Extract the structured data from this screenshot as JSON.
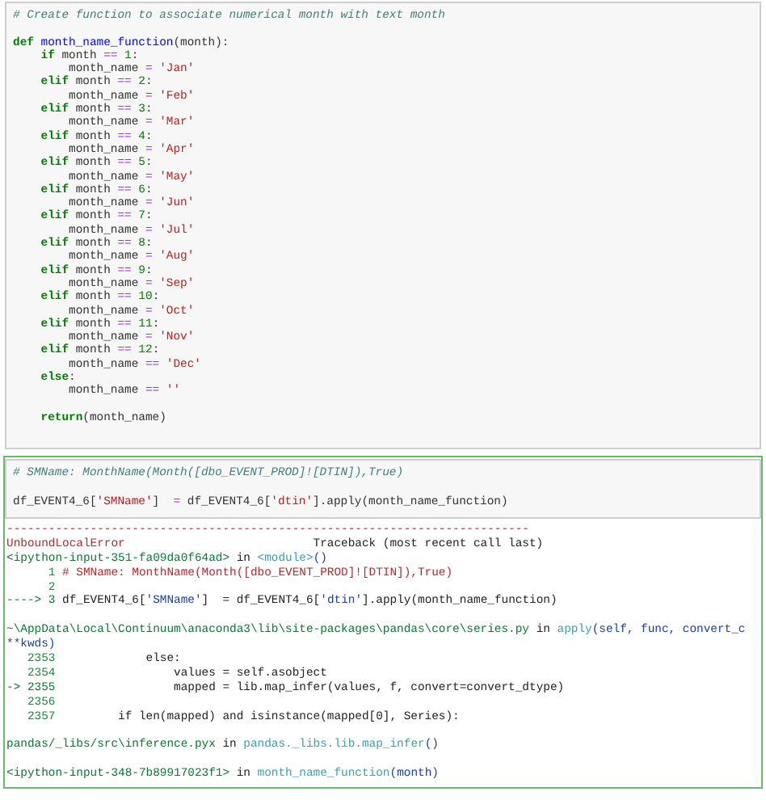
{
  "cells": [
    {
      "selected": false,
      "lines": [
        {
          "kind": "code",
          "tokens": [
            {
              "kind": "cm",
              "t": "# Create function to associate numerical month with text month"
            }
          ]
        },
        {
          "kind": "blank"
        },
        {
          "kind": "code",
          "tokens": [
            {
              "kind": "kw",
              "t": "def"
            },
            {
              "kind": "fn",
              "t": " month_name_function"
            },
            {
              "kind": "tx",
              "t": "(month):"
            }
          ]
        },
        {
          "kind": "code",
          "tokens": [
            {
              "kind": "kw",
              "t": "    if"
            },
            {
              "kind": "tx",
              "t": " month "
            },
            {
              "kind": "op",
              "t": "=="
            },
            {
              "kind": "num",
              "t": " 1"
            },
            {
              "kind": "tx",
              "t": ":"
            }
          ]
        },
        {
          "kind": "code",
          "tokens": [
            {
              "kind": "tx",
              "t": "        month_name "
            },
            {
              "kind": "op",
              "t": "="
            },
            {
              "kind": "str",
              "t": " 'Jan'"
            }
          ]
        },
        {
          "kind": "code",
          "tokens": [
            {
              "kind": "kw",
              "t": "    elif"
            },
            {
              "kind": "tx",
              "t": " month "
            },
            {
              "kind": "op",
              "t": "=="
            },
            {
              "kind": "num",
              "t": " 2"
            },
            {
              "kind": "tx",
              "t": ":"
            }
          ]
        },
        {
          "kind": "code",
          "tokens": [
            {
              "kind": "tx",
              "t": "        month_name "
            },
            {
              "kind": "op",
              "t": "="
            },
            {
              "kind": "str",
              "t": " 'Feb'"
            }
          ]
        },
        {
          "kind": "code",
          "tokens": [
            {
              "kind": "kw",
              "t": "    elif"
            },
            {
              "kind": "tx",
              "t": " month "
            },
            {
              "kind": "op",
              "t": "=="
            },
            {
              "kind": "num",
              "t": " 3"
            },
            {
              "kind": "tx",
              "t": ":"
            }
          ]
        },
        {
          "kind": "code",
          "tokens": [
            {
              "kind": "tx",
              "t": "        month_name "
            },
            {
              "kind": "op",
              "t": "="
            },
            {
              "kind": "str",
              "t": " 'Mar'"
            }
          ]
        },
        {
          "kind": "code",
          "tokens": [
            {
              "kind": "kw",
              "t": "    elif"
            },
            {
              "kind": "tx",
              "t": " month "
            },
            {
              "kind": "op",
              "t": "=="
            },
            {
              "kind": "num",
              "t": " 4"
            },
            {
              "kind": "tx",
              "t": ":"
            }
          ]
        },
        {
          "kind": "code",
          "tokens": [
            {
              "kind": "tx",
              "t": "        month_name "
            },
            {
              "kind": "op",
              "t": "="
            },
            {
              "kind": "str",
              "t": " 'Apr'"
            }
          ]
        },
        {
          "kind": "code",
          "tokens": [
            {
              "kind": "kw",
              "t": "    elif"
            },
            {
              "kind": "tx",
              "t": " month "
            },
            {
              "kind": "op",
              "t": "=="
            },
            {
              "kind": "num",
              "t": " 5"
            },
            {
              "kind": "tx",
              "t": ":"
            }
          ]
        },
        {
          "kind": "code",
          "tokens": [
            {
              "kind": "tx",
              "t": "        month_name "
            },
            {
              "kind": "op",
              "t": "="
            },
            {
              "kind": "str",
              "t": " 'May'"
            }
          ]
        },
        {
          "kind": "code",
          "tokens": [
            {
              "kind": "kw",
              "t": "    elif"
            },
            {
              "kind": "tx",
              "t": " month "
            },
            {
              "kind": "op",
              "t": "=="
            },
            {
              "kind": "num",
              "t": " 6"
            },
            {
              "kind": "tx",
              "t": ":"
            }
          ]
        },
        {
          "kind": "code",
          "tokens": [
            {
              "kind": "tx",
              "t": "        month_name "
            },
            {
              "kind": "op",
              "t": "="
            },
            {
              "kind": "str",
              "t": " 'Jun'"
            }
          ]
        },
        {
          "kind": "code",
          "tokens": [
            {
              "kind": "kw",
              "t": "    elif"
            },
            {
              "kind": "tx",
              "t": " month "
            },
            {
              "kind": "op",
              "t": "=="
            },
            {
              "kind": "num",
              "t": " 7"
            },
            {
              "kind": "tx",
              "t": ":"
            }
          ]
        },
        {
          "kind": "code",
          "tokens": [
            {
              "kind": "tx",
              "t": "        month_name "
            },
            {
              "kind": "op",
              "t": "="
            },
            {
              "kind": "str",
              "t": " 'Jul'"
            }
          ]
        },
        {
          "kind": "code",
          "tokens": [
            {
              "kind": "kw",
              "t": "    elif"
            },
            {
              "kind": "tx",
              "t": " month "
            },
            {
              "kind": "op",
              "t": "=="
            },
            {
              "kind": "num",
              "t": " 8"
            },
            {
              "kind": "tx",
              "t": ":"
            }
          ]
        },
        {
          "kind": "code",
          "tokens": [
            {
              "kind": "tx",
              "t": "        month_name "
            },
            {
              "kind": "op",
              "t": "="
            },
            {
              "kind": "str",
              "t": " 'Aug'"
            }
          ]
        },
        {
          "kind": "code",
          "tokens": [
            {
              "kind": "kw",
              "t": "    elif"
            },
            {
              "kind": "tx",
              "t": " month "
            },
            {
              "kind": "op",
              "t": "=="
            },
            {
              "kind": "num",
              "t": " 9"
            },
            {
              "kind": "tx",
              "t": ":"
            }
          ]
        },
        {
          "kind": "code",
          "tokens": [
            {
              "kind": "tx",
              "t": "        month_name "
            },
            {
              "kind": "op",
              "t": "="
            },
            {
              "kind": "str",
              "t": " 'Sep'"
            }
          ]
        },
        {
          "kind": "code",
          "tokens": [
            {
              "kind": "kw",
              "t": "    elif"
            },
            {
              "kind": "tx",
              "t": " month "
            },
            {
              "kind": "op",
              "t": "=="
            },
            {
              "kind": "num",
              "t": " 10"
            },
            {
              "kind": "tx",
              "t": ":"
            }
          ]
        },
        {
          "kind": "code",
          "tokens": [
            {
              "kind": "tx",
              "t": "        month_name "
            },
            {
              "kind": "op",
              "t": "="
            },
            {
              "kind": "str",
              "t": " 'Oct'"
            }
          ]
        },
        {
          "kind": "code",
          "tokens": [
            {
              "kind": "kw",
              "t": "    elif"
            },
            {
              "kind": "tx",
              "t": " month "
            },
            {
              "kind": "op",
              "t": "=="
            },
            {
              "kind": "num",
              "t": " 11"
            },
            {
              "kind": "tx",
              "t": ":"
            }
          ]
        },
        {
          "kind": "code",
          "tokens": [
            {
              "kind": "tx",
              "t": "        month_name "
            },
            {
              "kind": "op",
              "t": "="
            },
            {
              "kind": "str",
              "t": " 'Nov'"
            }
          ]
        },
        {
          "kind": "code",
          "tokens": [
            {
              "kind": "kw",
              "t": "    elif"
            },
            {
              "kind": "tx",
              "t": " month "
            },
            {
              "kind": "op",
              "t": "=="
            },
            {
              "kind": "num",
              "t": " 12"
            },
            {
              "kind": "tx",
              "t": ":"
            }
          ]
        },
        {
          "kind": "code",
          "tokens": [
            {
              "kind": "tx",
              "t": "        month_name "
            },
            {
              "kind": "op",
              "t": "=="
            },
            {
              "kind": "str",
              "t": " 'Dec'"
            }
          ]
        },
        {
          "kind": "code",
          "tokens": [
            {
              "kind": "kw",
              "t": "    else"
            },
            {
              "kind": "tx",
              "t": ":"
            }
          ]
        },
        {
          "kind": "code",
          "tokens": [
            {
              "kind": "tx",
              "t": "        month_name "
            },
            {
              "kind": "op",
              "t": "=="
            },
            {
              "kind": "str",
              "t": " ''"
            }
          ]
        },
        {
          "kind": "blank"
        },
        {
          "kind": "code",
          "tokens": [
            {
              "kind": "kw",
              "t": "    return"
            },
            {
              "kind": "tx",
              "t": "(month_name)"
            }
          ]
        }
      ]
    },
    {
      "selected": true,
      "lines": [
        {
          "kind": "code",
          "tokens": [
            {
              "kind": "cm",
              "t": "# SMName: MonthName(Month([dbo_EVENT_PROD]![DTIN]),True)"
            }
          ]
        },
        {
          "kind": "blank"
        },
        {
          "kind": "code",
          "tokens": [
            {
              "kind": "tx",
              "t": "df_EVENT4_6["
            },
            {
              "kind": "str",
              "t": "'SMName'"
            },
            {
              "kind": "tx",
              "t": "]  "
            },
            {
              "kind": "op",
              "t": "="
            },
            {
              "kind": "tx",
              "t": " df_EVENT4_6["
            },
            {
              "kind": "str",
              "t": "'dtin'"
            },
            {
              "kind": "tx",
              "t": "].apply(month_name_function)"
            }
          ]
        }
      ],
      "output": [
        {
          "kind": "code",
          "tokens": [
            {
              "kind": "err",
              "t": "---------------------------------------------------------------------------"
            }
          ]
        },
        {
          "kind": "code",
          "tokens": [
            {
              "kind": "err",
              "t": "UnboundLocalError"
            },
            {
              "kind": "tx",
              "t": "                           Traceback (most recent call last)"
            }
          ]
        },
        {
          "kind": "code",
          "tokens": [
            {
              "kind": "grn",
              "t": "<ipython-input-351-fa09da0f64ad>"
            },
            {
              "kind": "tx",
              "t": " in "
            },
            {
              "kind": "cy",
              "t": "<module>"
            },
            {
              "kind": "arg",
              "t": "()"
            }
          ]
        },
        {
          "kind": "code",
          "tokens": [
            {
              "kind": "lno",
              "t": "      1 "
            },
            {
              "kind": "err",
              "t": "# SMName: MonthName(Month([dbo_EVENT_PROD]![DTIN]),True)"
            }
          ]
        },
        {
          "kind": "code",
          "tokens": [
            {
              "kind": "lno",
              "t": "      2"
            }
          ]
        },
        {
          "kind": "code",
          "tokens": [
            {
              "kind": "grn",
              "t": "----> 3 "
            },
            {
              "kind": "tx",
              "t": "df_EVENT4_6["
            },
            {
              "kind": "arg",
              "t": "'SMName'"
            },
            {
              "kind": "tx",
              "t": "]  = df_EVENT4_6["
            },
            {
              "kind": "arg",
              "t": "'dtin'"
            },
            {
              "kind": "tx",
              "t": "].apply(month_name_function)"
            }
          ]
        },
        {
          "kind": "blank"
        },
        {
          "kind": "code",
          "tokens": [
            {
              "kind": "grn",
              "t": "~\\AppData\\Local\\Continuum\\anaconda3\\lib\\site-packages\\pandas\\core\\series.py"
            },
            {
              "kind": "tx",
              "t": " in "
            },
            {
              "kind": "cy",
              "t": "apply"
            },
            {
              "kind": "arg",
              "t": "(self, func, convert_c"
            }
          ]
        },
        {
          "kind": "code",
          "tokens": [
            {
              "kind": "arg",
              "t": "**kwds)"
            }
          ]
        },
        {
          "kind": "code",
          "tokens": [
            {
              "kind": "lno",
              "t": "   2353 "
            },
            {
              "kind": "tx",
              "t": "            else:"
            }
          ]
        },
        {
          "kind": "code",
          "tokens": [
            {
              "kind": "lno",
              "t": "   2354 "
            },
            {
              "kind": "tx",
              "t": "                values = self.asobject"
            }
          ]
        },
        {
          "kind": "code",
          "tokens": [
            {
              "kind": "grn",
              "t": "-> 2355 "
            },
            {
              "kind": "tx",
              "t": "                mapped = lib.map_infer(values, f, convert=convert_dtype)"
            }
          ]
        },
        {
          "kind": "code",
          "tokens": [
            {
              "kind": "lno",
              "t": "   2356"
            }
          ]
        },
        {
          "kind": "code",
          "tokens": [
            {
              "kind": "lno",
              "t": "   2357 "
            },
            {
              "kind": "tx",
              "t": "        if len(mapped) and isinstance(mapped[0], Series):"
            }
          ]
        },
        {
          "kind": "blank"
        },
        {
          "kind": "code",
          "tokens": [
            {
              "kind": "grn",
              "t": "pandas/_libs/src\\inference.pyx"
            },
            {
              "kind": "tx",
              "t": " in "
            },
            {
              "kind": "cy",
              "t": "pandas._libs.lib.map_infer"
            },
            {
              "kind": "arg",
              "t": "()"
            }
          ]
        },
        {
          "kind": "blank"
        },
        {
          "kind": "code",
          "tokens": [
            {
              "kind": "grn",
              "t": "<ipython-input-348-7b89917023f1>"
            },
            {
              "kind": "tx",
              "t": " in "
            },
            {
              "kind": "cy",
              "t": "month_name_function"
            },
            {
              "kind": "arg",
              "t": "(month)"
            }
          ]
        }
      ]
    }
  ]
}
